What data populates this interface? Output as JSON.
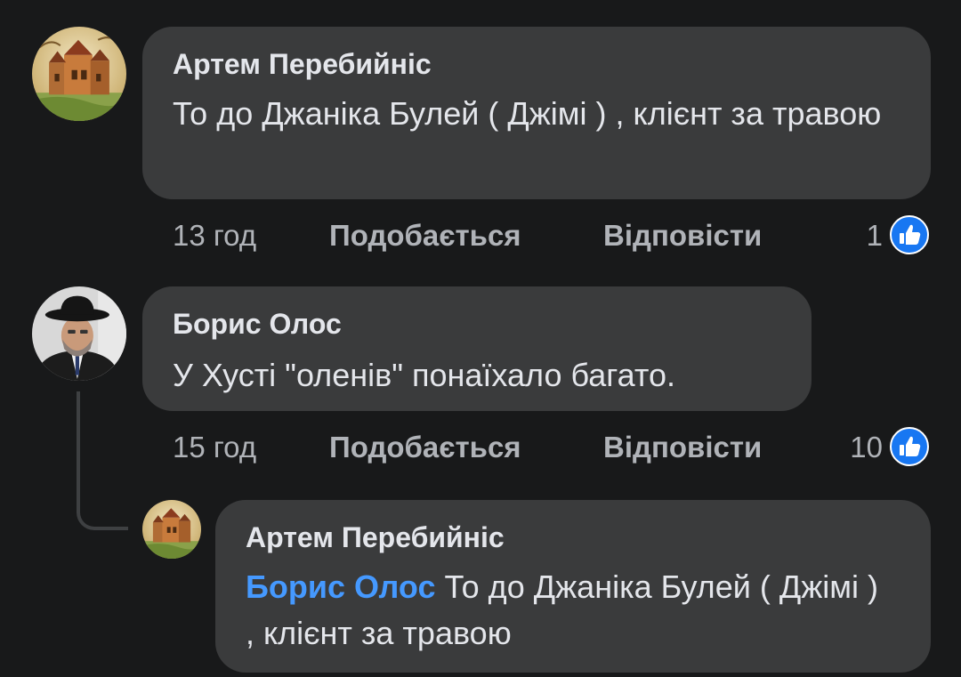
{
  "comments": [
    {
      "author": "Артем Перебийніс",
      "text": "То до Джаніка Булей ( Джімі ) , клієнт за травою",
      "time": "13 год",
      "like_label": "Подобається",
      "reply_label": "Відповісти",
      "reaction_count": "1",
      "reaction_icon": "thumbs-up-icon"
    },
    {
      "author": "Борис Олос",
      "text": "У Хусті \"оленів\" понаїхало багато.",
      "time": "15 год",
      "like_label": "Подобається",
      "reply_label": "Відповісти",
      "reaction_count": "10",
      "reaction_icon": "thumbs-up-icon",
      "replies": [
        {
          "author": "Артем Перебийніс",
          "mention": "Борис Олос",
          "text": "То до Джаніка Булей ( Джімі ) , клієнт за травою"
        }
      ]
    }
  ],
  "colors": {
    "background": "#18191a",
    "bubble": "#3a3b3c",
    "mention": "#4599ff",
    "like_badge": "#1877f2"
  }
}
